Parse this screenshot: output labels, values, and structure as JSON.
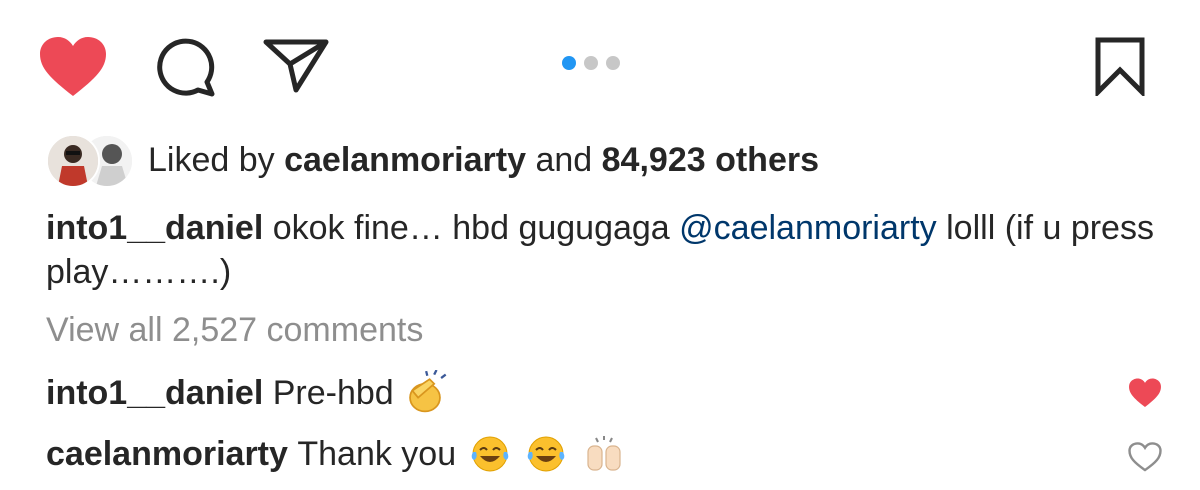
{
  "action_bar": {
    "like_icon": "heart-filled-icon",
    "comment_icon": "comment-bubble-icon",
    "share_icon": "paper-plane-icon",
    "save_icon": "bookmark-icon",
    "like_color": "#ed4956",
    "carousel": {
      "count": 3,
      "active": 1,
      "active_color": "#2196f3"
    }
  },
  "likes": {
    "prefix": "Liked by",
    "user": "caelanmoriarty",
    "conjunction": "and",
    "count": "84,923 others"
  },
  "caption": {
    "username": "into1__daniel",
    "text_before": "okok fine… hbd gugugaga",
    "mention": "@caelanmoriarty",
    "text_after": "lolll (if u press play……….)"
  },
  "view_all_comments": "View all 2,527 comments",
  "comments": [
    {
      "username": "into1__daniel",
      "text": "Pre-hbd",
      "emojis": [
        "clapping-hands-emoji"
      ],
      "liked": true
    },
    {
      "username": "caelanmoriarty",
      "text": "Thank you",
      "emojis": [
        "tears-of-joy-emoji",
        "tears-of-joy-emoji",
        "raising-hands-emoji"
      ],
      "liked": false
    }
  ]
}
